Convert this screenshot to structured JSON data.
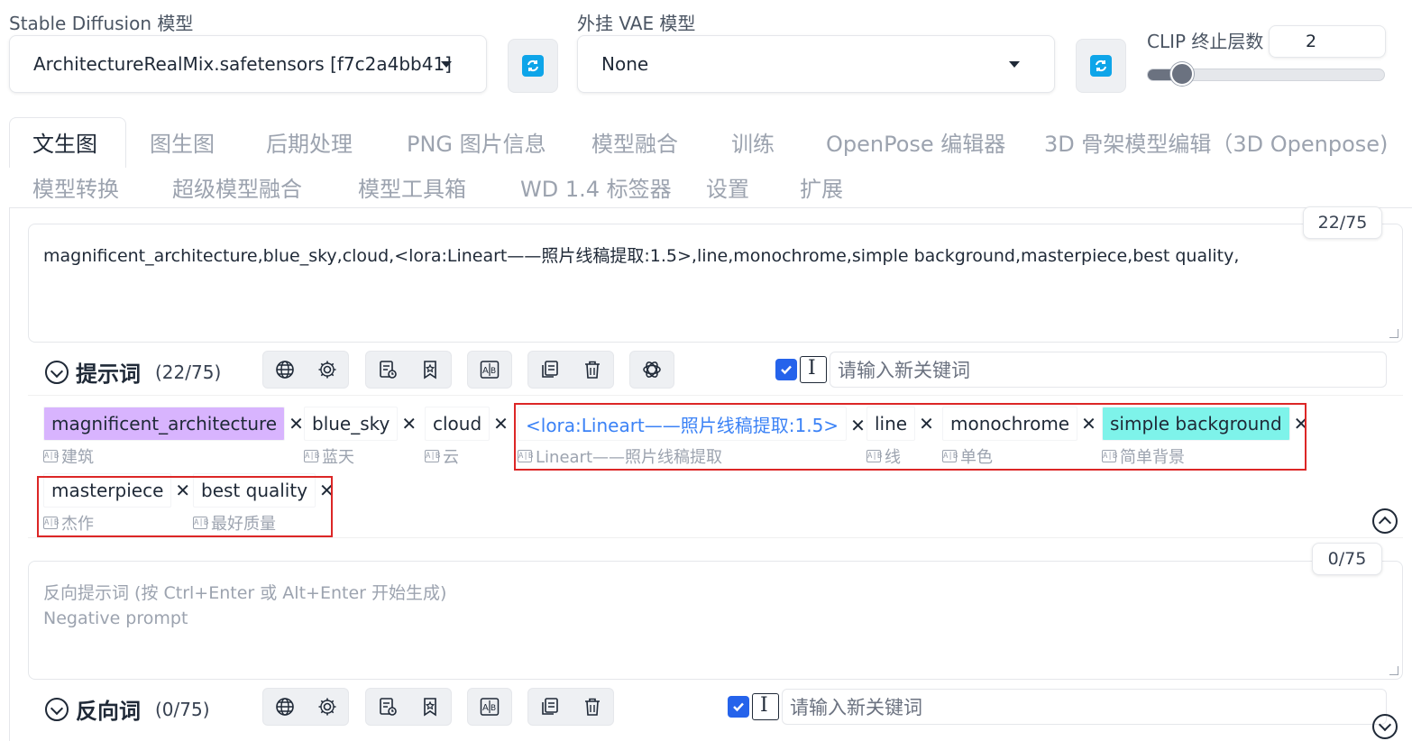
{
  "model": {
    "sd_label": "Stable Diffusion 模型",
    "sd_value": "ArchitectureRealMix.safetensors [f7c2a4bb41]",
    "vae_label": "外挂 VAE 模型",
    "vae_value": "None",
    "clip_label": "CLIP 终止层数",
    "clip_value": "2",
    "clip_slider_fraction": 0.12,
    "accent": "#0ea5e9"
  },
  "tabs": [
    "文生图",
    "图生图",
    "后期处理",
    "PNG 图片信息",
    "模型融合",
    "训练",
    "OpenPose 编辑器",
    "3D 骨架模型编辑（3D Openpose)",
    "模型转换",
    "超级模型融合",
    "模型工具箱",
    "WD 1.4 标签器",
    "设置",
    "扩展"
  ],
  "positive": {
    "text": "magnificent_architecture,blue_sky,cloud,<lora:Lineart——照片线稿提取:1.5>,line,monochrome,simple background,masterpiece,best quality,",
    "counter": "22/75",
    "section_title": "提示词",
    "section_count": "(22/75)",
    "keyword_placeholder": "请输入新关键词",
    "tags": [
      {
        "text": "magnificent_architecture",
        "sub": "建筑",
        "bg": "#d8b4fe"
      },
      {
        "text": "blue_sky",
        "sub": "蓝天",
        "bg": "#ffffff"
      },
      {
        "text": "cloud",
        "sub": "云",
        "bg": "#ffffff"
      },
      {
        "text": "<lora:Lineart——照片线稿提取:1.5>",
        "sub": "Lineart——照片线稿提取",
        "bg": "#ffffff",
        "color": "#3b82f6"
      },
      {
        "text": "line",
        "sub": "线",
        "bg": "#ffffff"
      },
      {
        "text": "monochrome",
        "sub": "单色",
        "bg": "#ffffff"
      },
      {
        "text": "simple background",
        "sub": "简单背景",
        "bg": "#7ef3ea"
      },
      {
        "text": "masterpiece",
        "sub": "杰作",
        "bg": "#ffffff"
      },
      {
        "text": "best quality",
        "sub": "最好质量",
        "bg": "#ffffff"
      }
    ]
  },
  "negative": {
    "placeholder_line1": "反向提示词 (按 Ctrl+Enter 或 Alt+Enter 开始生成)",
    "placeholder_line2": "Negative prompt",
    "counter": "0/75",
    "section_title": "反向词",
    "section_count": "(0/75)",
    "keyword_placeholder": "请输入新关键词"
  },
  "icons": [
    "refresh-icon",
    "globe-icon",
    "gear-icon",
    "clipboard-history-icon",
    "bookmark-icon",
    "translate-icon",
    "copy-icon",
    "trash-icon",
    "openai-icon",
    "checkbox-icon",
    "text-cursor-icon",
    "chevron-circle-icon"
  ],
  "annotation_color": "#dc2626"
}
